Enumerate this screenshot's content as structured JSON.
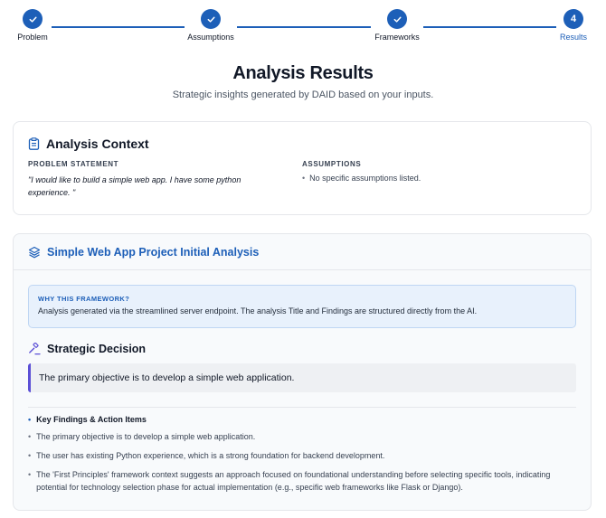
{
  "stepper": {
    "steps": [
      {
        "label": "Problem",
        "state": "done",
        "marker": "check-icon"
      },
      {
        "label": "Assumptions",
        "state": "done",
        "marker": "check-icon"
      },
      {
        "label": "Frameworks",
        "state": "done",
        "marker": "check-icon"
      },
      {
        "label": "Results",
        "state": "active",
        "number": "4"
      }
    ],
    "accent": "#1d5fb8"
  },
  "header": {
    "title": "Analysis Results",
    "subtitle": "Strategic insights generated by DAID based on your inputs."
  },
  "context": {
    "icon": "clipboard-icon",
    "title": "Analysis Context",
    "problem_heading": "PROBLEM STATEMENT",
    "problem_text": "\"I would like to build a simple web app. I have some python experience. \"",
    "assumptions_heading": "ASSUMPTIONS",
    "assumptions": [
      "No specific assumptions listed."
    ]
  },
  "framework": {
    "icon": "layers-icon",
    "title": "Simple Web App Project Initial Analysis",
    "why_heading": "WHY THIS FRAMEWORK?",
    "why_text": "Analysis generated via the streamlined server endpoint. The analysis Title and Findings are structured directly from the AI.",
    "decision_icon": "gavel-icon",
    "decision_title": "Strategic Decision",
    "decision_text": "The primary objective is to develop a simple web application.",
    "findings_heading": "Key Findings & Action Items",
    "findings": [
      "The primary objective is to develop a simple web application.",
      "The user has existing Python experience, which is a strong foundation for backend development.",
      "The 'First Principles' framework context suggests an approach focused on foundational understanding before selecting specific tools, indicating potential for technology selection phase for actual implementation (e.g., specific web frameworks like Flask or Django)."
    ]
  }
}
